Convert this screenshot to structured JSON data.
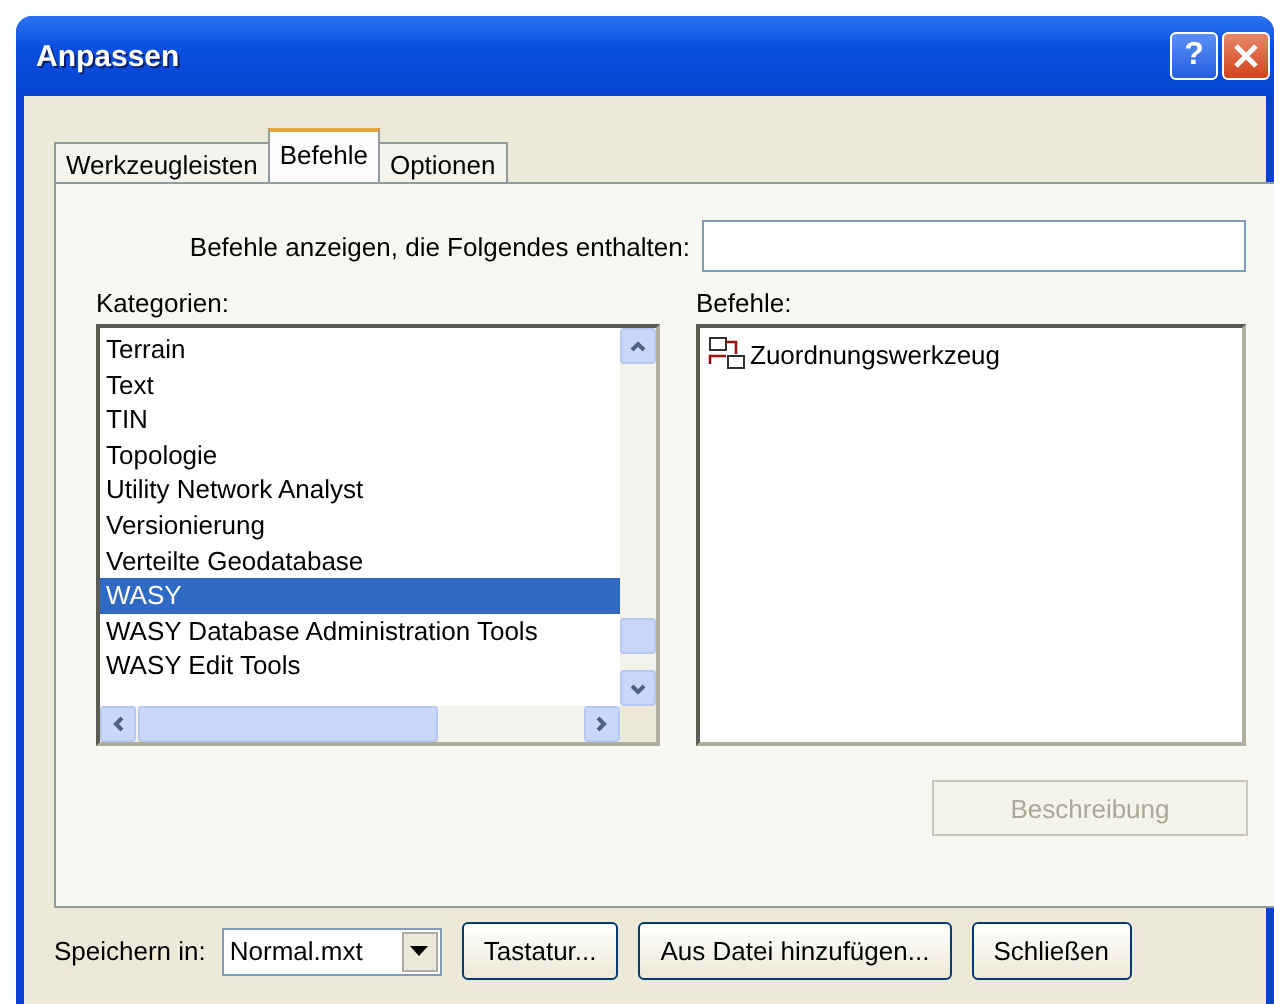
{
  "window": {
    "title": "Anpassen",
    "help_button": "?"
  },
  "tabs": [
    {
      "label": "Werkzeugleisten",
      "selected": false
    },
    {
      "label": "Befehle",
      "selected": true
    },
    {
      "label": "Optionen",
      "selected": false
    }
  ],
  "search": {
    "label": "Befehle anzeigen, die Folgendes enthalten:"
  },
  "categories": {
    "label": "Kategorien:",
    "items": [
      {
        "label": "Terrain",
        "selected": false
      },
      {
        "label": "Text",
        "selected": false
      },
      {
        "label": "TIN",
        "selected": false
      },
      {
        "label": "Topologie",
        "selected": false
      },
      {
        "label": "Utility Network Analyst",
        "selected": false
      },
      {
        "label": "Versionierung",
        "selected": false
      },
      {
        "label": "Verteilte Geodatabase",
        "selected": false
      },
      {
        "label": "WASY",
        "selected": true
      },
      {
        "label": "WASY Database Administration Tools",
        "selected": false
      },
      {
        "label": "WASY Edit Tools",
        "selected": false
      }
    ]
  },
  "commands": {
    "label": "Befehle:",
    "items": [
      {
        "label": "Zuordnungswerkzeug"
      }
    ]
  },
  "description_button": {
    "label": "Beschreibung",
    "disabled": true
  },
  "footer": {
    "save_label": "Speichern in:",
    "save_value": "Normal.mxt",
    "buttons": [
      "Tastatur...",
      "Aus Datei hinzufügen...",
      "Schließen"
    ]
  }
}
